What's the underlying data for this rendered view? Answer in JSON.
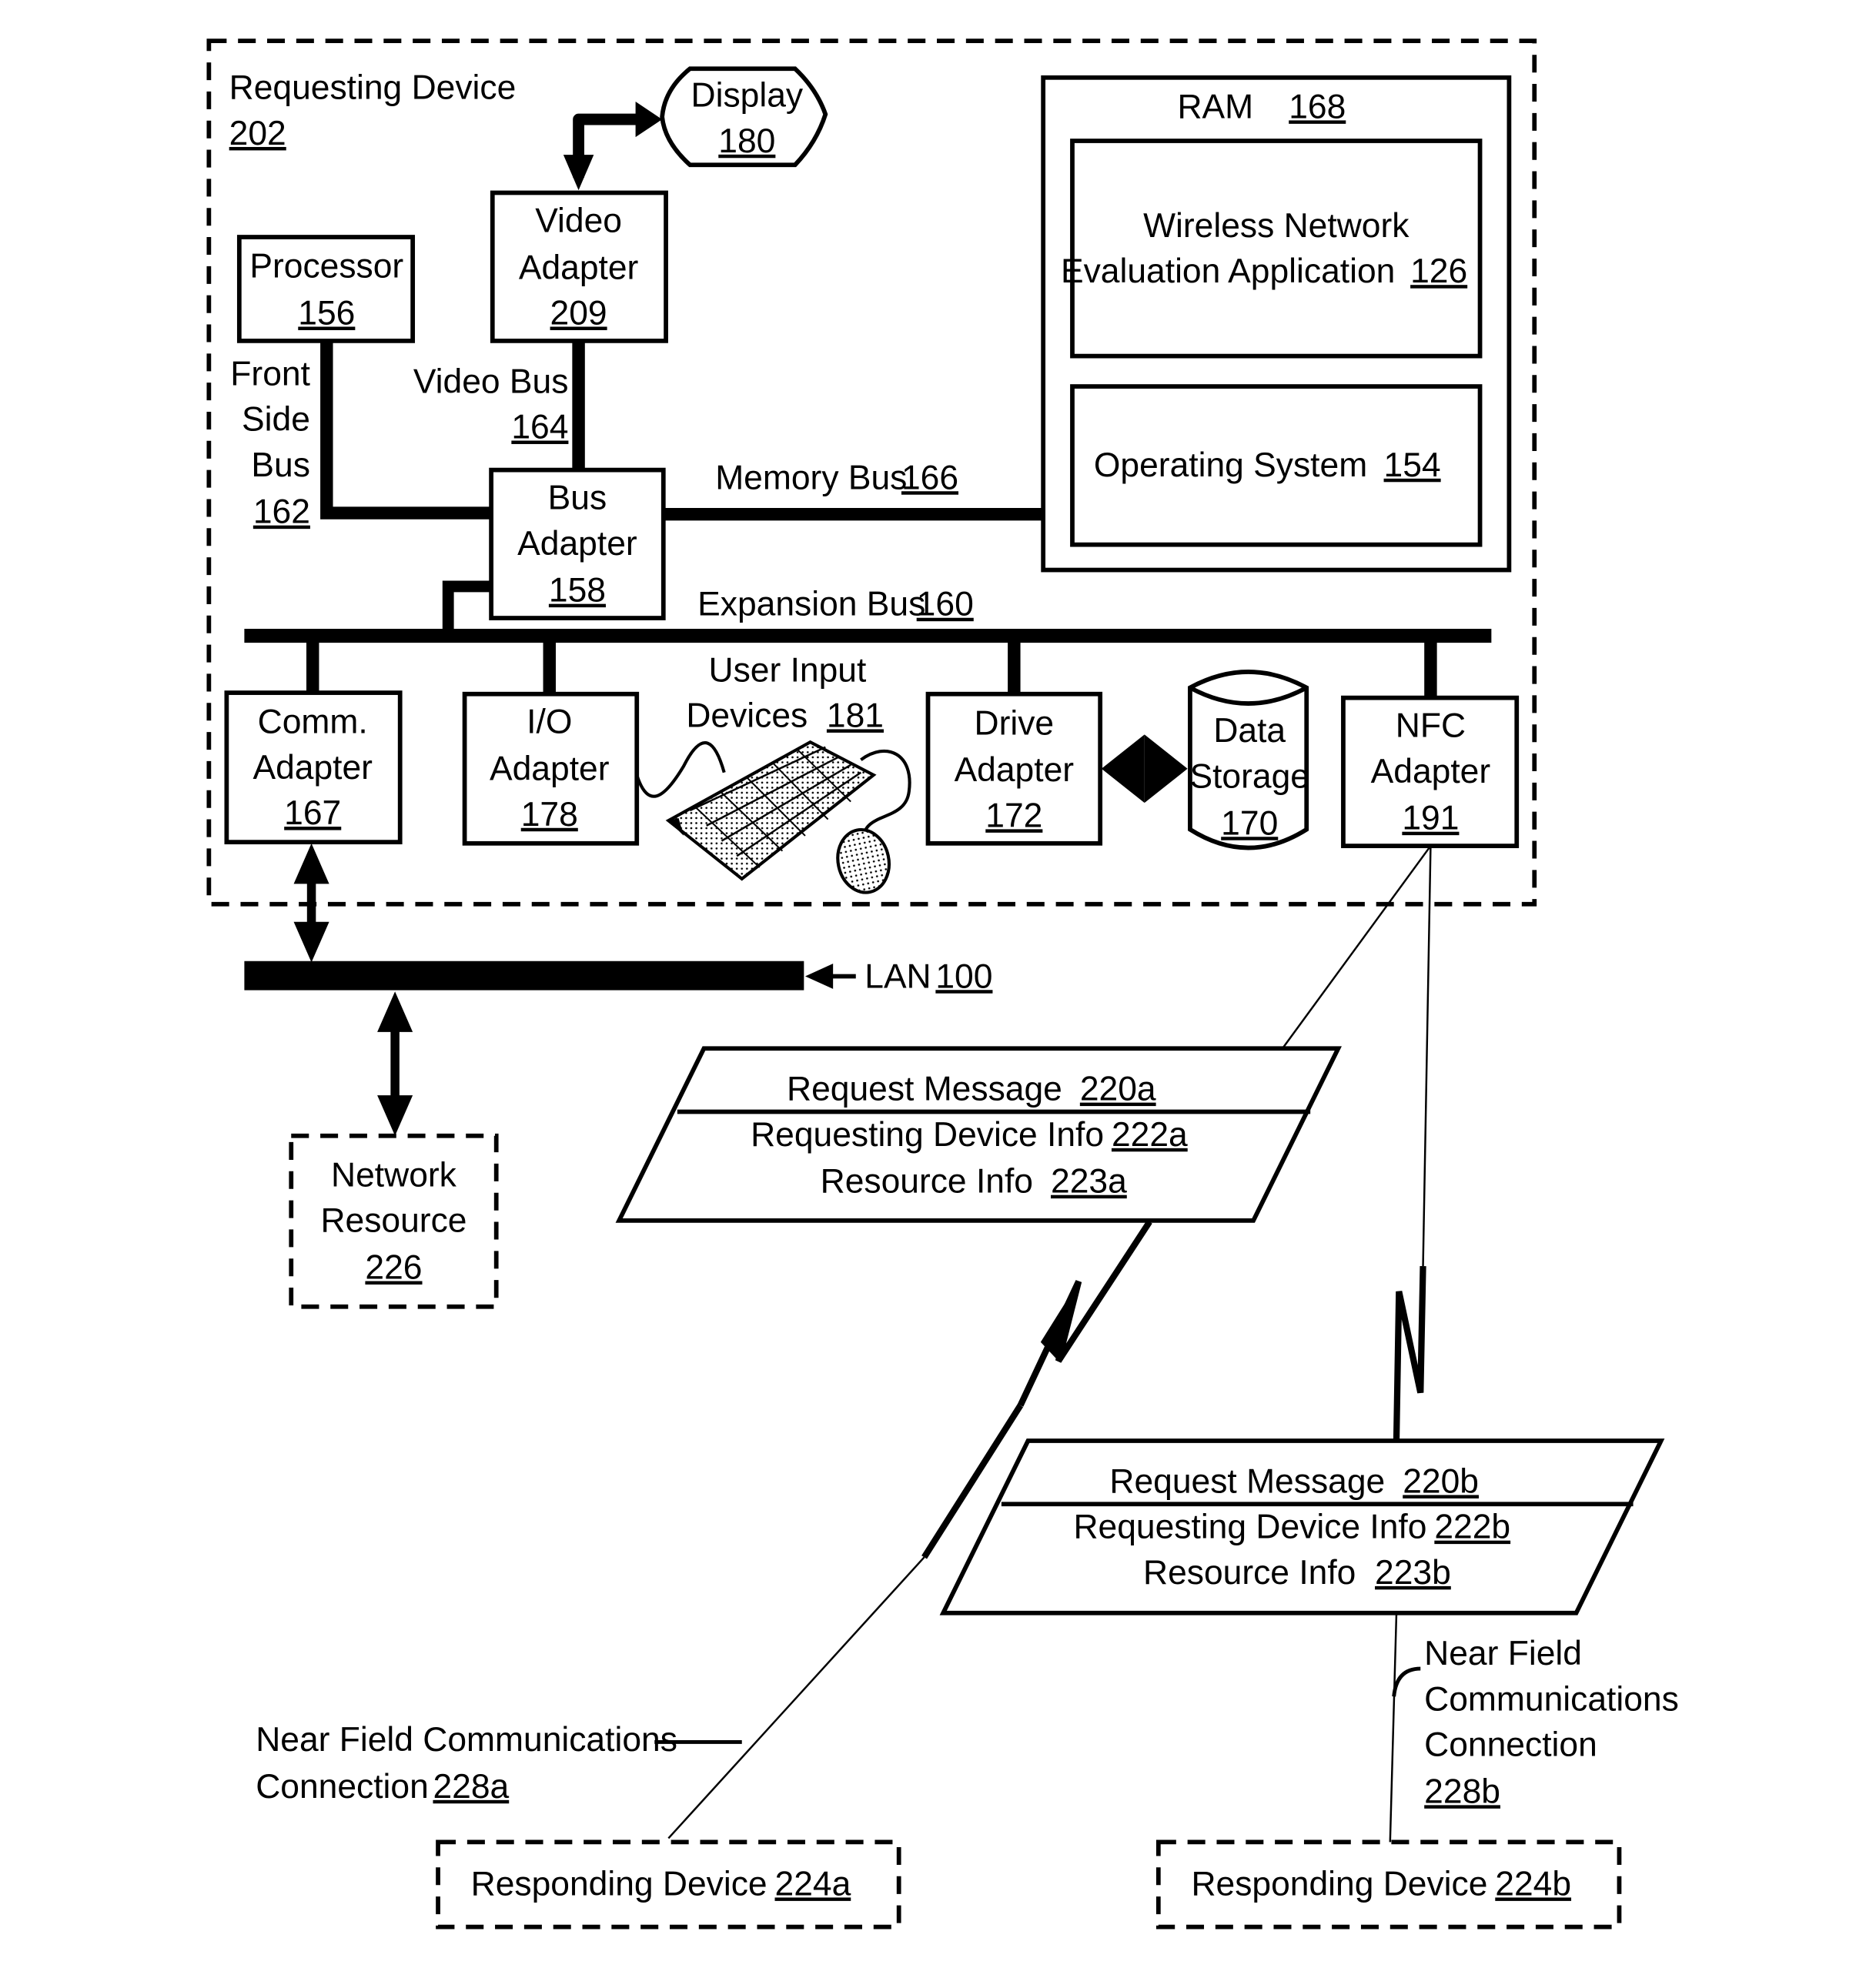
{
  "diagram": {
    "requesting_device": {
      "label": "Requesting Device",
      "ref": "202"
    },
    "display": {
      "label": "Display",
      "ref": "180"
    },
    "video_adapter": {
      "line1": "Video",
      "line2": "Adapter",
      "ref": "209"
    },
    "processor": {
      "label": "Processor",
      "ref": "156"
    },
    "front_side_bus": {
      "line1": "Front",
      "line2": "Side",
      "line3": "Bus",
      "ref": "162"
    },
    "video_bus": {
      "label": "Video Bus",
      "ref": "164"
    },
    "bus_adapter": {
      "line1": "Bus",
      "line2": "Adapter",
      "ref": "158"
    },
    "memory_bus": {
      "label": "Memory Bus",
      "ref": "166"
    },
    "expansion_bus": {
      "label": "Expansion Bus",
      "ref": "160"
    },
    "ram": {
      "label": "RAM",
      "ref": "168"
    },
    "wireless_app": {
      "line1": "Wireless Network",
      "line2": "Evaluation Application",
      "ref": "126"
    },
    "operating_system": {
      "label": "Operating System",
      "ref": "154"
    },
    "comm_adapter": {
      "line1": "Comm.",
      "line2": "Adapter",
      "ref": "167"
    },
    "io_adapter": {
      "line1": "I/O",
      "line2": "Adapter",
      "ref": "178"
    },
    "user_input": {
      "line1": "User Input",
      "line2": "Devices",
      "ref": "181"
    },
    "drive_adapter": {
      "line1": "Drive",
      "line2": "Adapter",
      "ref": "172"
    },
    "data_storage": {
      "line1": "Data",
      "line2": "Storage",
      "ref": "170"
    },
    "nfc_adapter": {
      "line1": "NFC",
      "line2": "Adapter",
      "ref": "191"
    },
    "lan": {
      "label": "LAN",
      "ref": "100"
    },
    "network_resource": {
      "line1": "Network",
      "line2": "Resource",
      "ref": "226"
    },
    "request_a": {
      "title": "Request Message",
      "title_ref": "220a",
      "device_info": "Requesting Device Info",
      "device_info_ref": "222a",
      "resource_info": "Resource Info",
      "resource_info_ref": "223a"
    },
    "request_b": {
      "title": "Request Message",
      "title_ref": "220b",
      "device_info": "Requesting Device Info",
      "device_info_ref": "222b",
      "resource_info": "Resource Info",
      "resource_info_ref": "223b"
    },
    "nfc_conn_a": {
      "line1": "Near Field Communications",
      "line2": "Connection",
      "ref": "228a"
    },
    "nfc_conn_b": {
      "line1": "Near Field",
      "line2": "Communications",
      "line3": "Connection",
      "ref": "228b"
    },
    "responding_a": {
      "label": "Responding Device",
      "ref": "224a"
    },
    "responding_b": {
      "label": "Responding Device",
      "ref": "224b"
    }
  }
}
